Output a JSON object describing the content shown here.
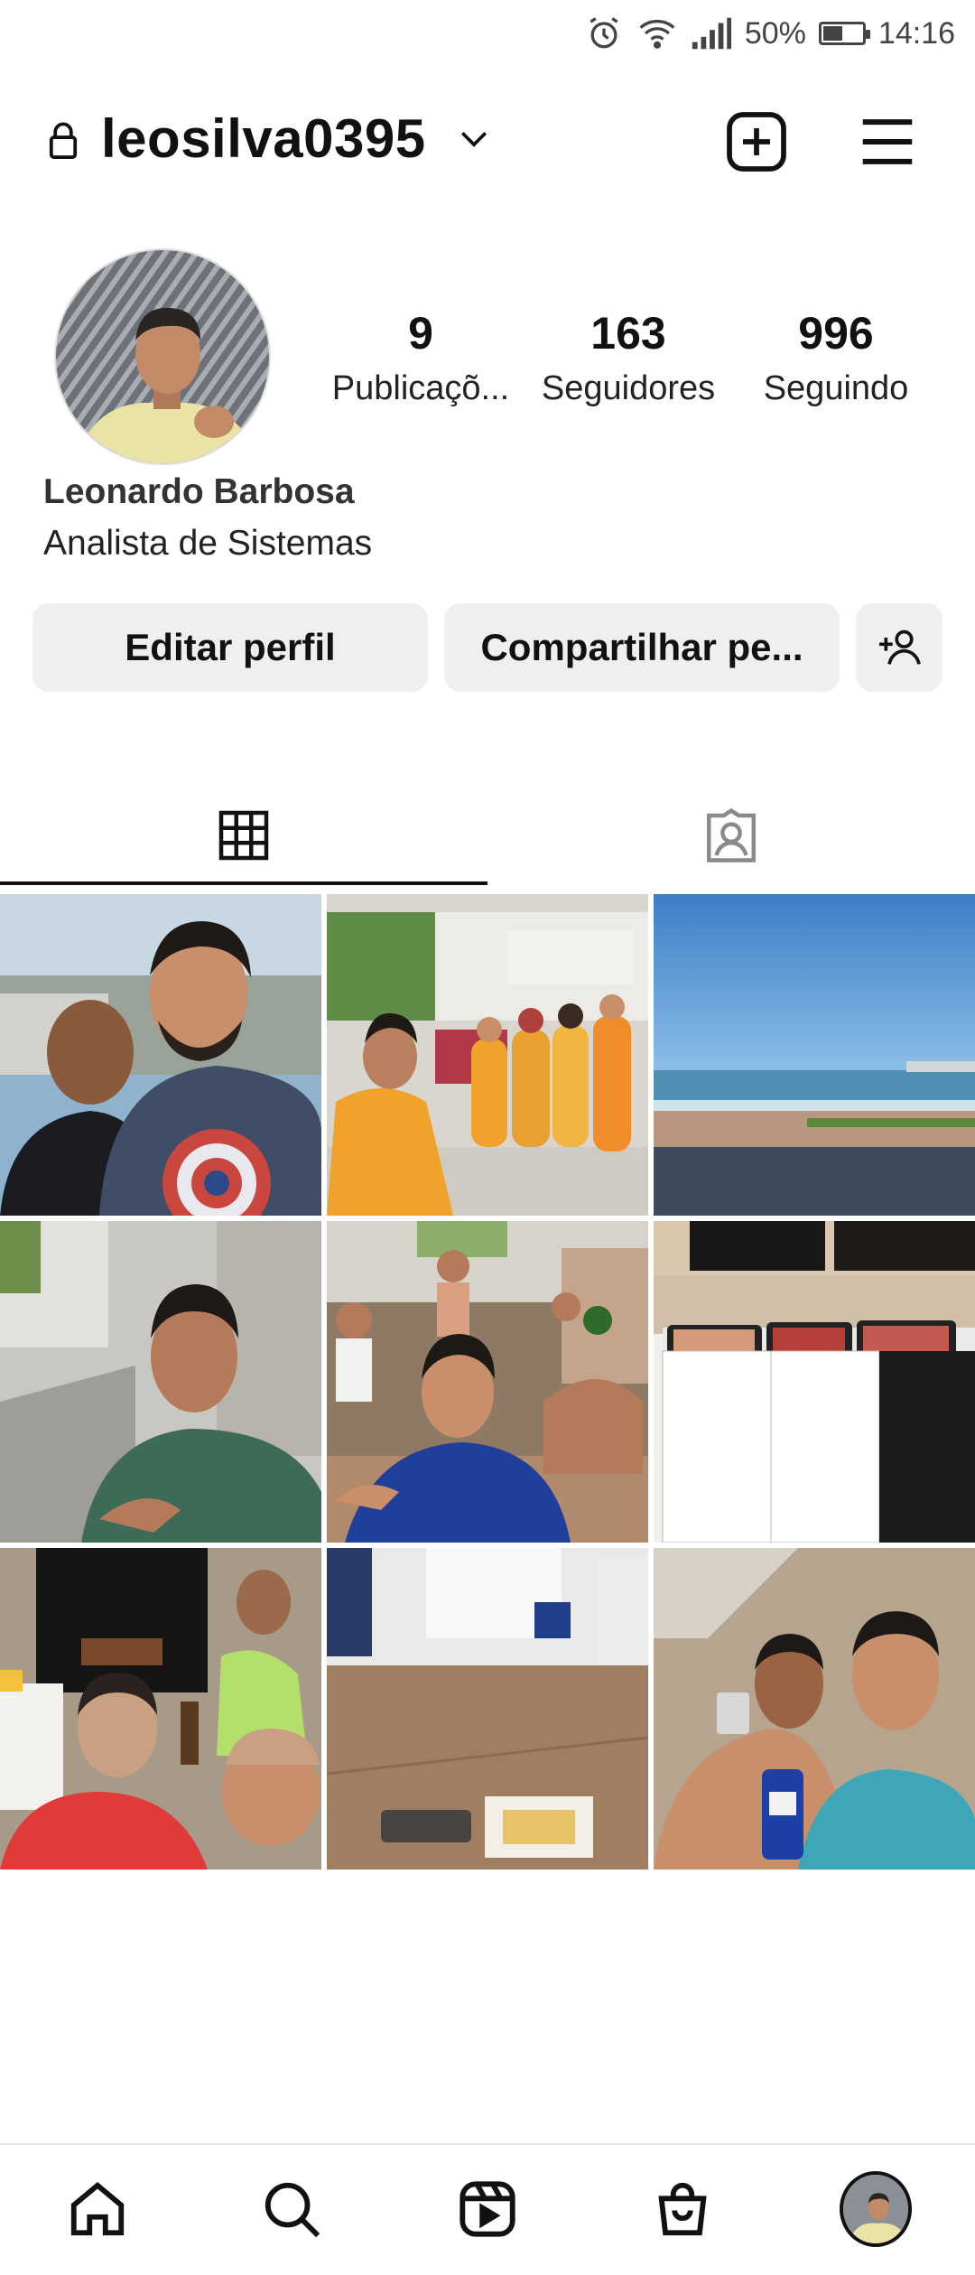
{
  "status_bar": {
    "battery": "50%",
    "time": "14:16",
    "battery_level": 0.5
  },
  "header": {
    "username": "leosilva0395"
  },
  "profile": {
    "posts_count": "9",
    "posts_label": "Publicaçõ...",
    "followers_count": "163",
    "followers_label": "Seguidores",
    "following_count": "996",
    "following_label": "Seguindo",
    "full_name": "Leonardo Barbosa",
    "bio": "Analista de Sistemas"
  },
  "actions": {
    "edit_label": "Editar perfil",
    "share_label": "Compartilhar pe..."
  },
  "tabs": [
    {
      "icon": "grid-icon",
      "selected": true
    },
    {
      "icon": "tagged-icon",
      "selected": false
    }
  ],
  "posts": [
    {
      "name": "post-1"
    },
    {
      "name": "post-2"
    },
    {
      "name": "post-3"
    },
    {
      "name": "post-4"
    },
    {
      "name": "post-5"
    },
    {
      "name": "post-6"
    },
    {
      "name": "post-7"
    },
    {
      "name": "post-8"
    },
    {
      "name": "post-9"
    }
  ],
  "bottom_nav": [
    "home-icon",
    "search-icon",
    "reels-icon",
    "shop-icon",
    "profile-avatar"
  ],
  "colors": {
    "text": "#111111",
    "button_bg": "#efefef",
    "divider": "#e6e6e6"
  }
}
